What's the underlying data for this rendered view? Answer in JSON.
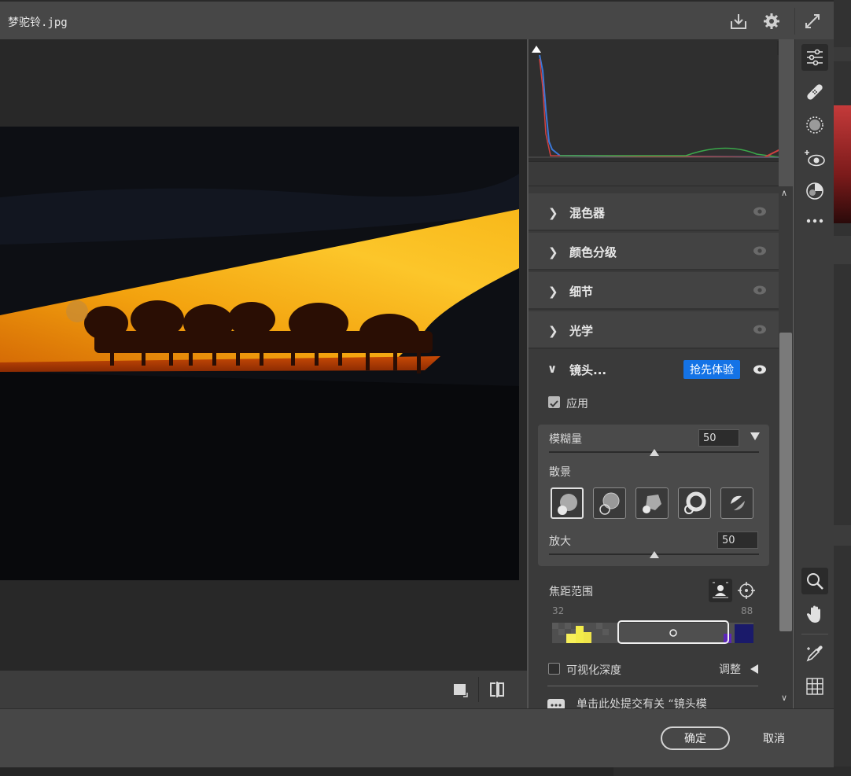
{
  "window": {
    "title": "梦驼铃.jpg"
  },
  "panel": {
    "sections": [
      {
        "label": "混色器"
      },
      {
        "label": "颜色分级"
      },
      {
        "label": "细节"
      },
      {
        "label": "光学"
      }
    ],
    "lens": {
      "label": "镜头...",
      "badge": "抢先体验",
      "apply_label": "应用",
      "apply_checked": true,
      "blur_label": "模糊量",
      "blur_value": "50",
      "blur_level": 0.5,
      "bokeh_label": "散景",
      "zoom_label": "放大",
      "zoom_value": "50",
      "zoom_level": 0.5,
      "focus_label": "焦距范围",
      "focus_min": "32",
      "focus_max": "88",
      "visualize_label": "可视化深度",
      "visualize_checked": false,
      "adjust_label": "调整",
      "feedback_text": "单击此处提交有关 “镜头模"
    }
  },
  "footer": {
    "ok_label": "确定",
    "cancel_label": "取消"
  },
  "colors": {
    "accent": "#1473e6",
    "panel_bg": "#3a3a3a",
    "dialog_bg": "#535353"
  }
}
